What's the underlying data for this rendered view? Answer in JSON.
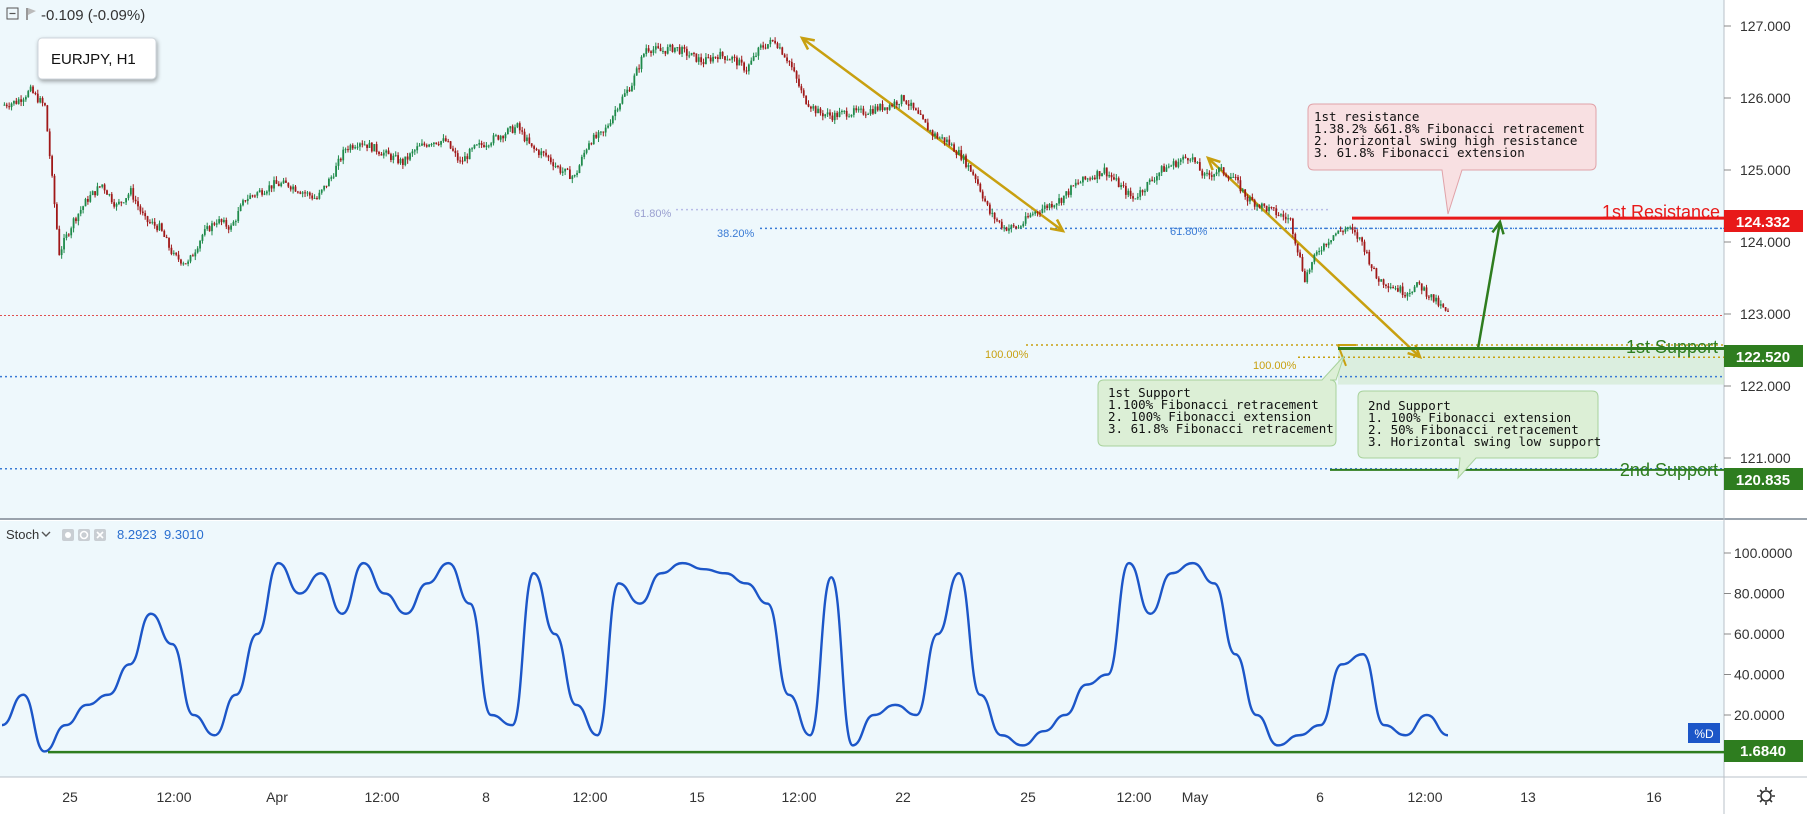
{
  "header": {
    "change": "-0.109 (-0.09%)",
    "symbol": "EURJPY, H1"
  },
  "colors": {
    "background": "#eef8fc",
    "up_candle": "#1e8a4a",
    "down_candle": "#a01818",
    "resistance": "#e81919",
    "support": "#2e7d1f",
    "fib_arrow": "#c8a010",
    "fib_blue": "#3a7bd5",
    "stoch_line": "#1c56c8"
  },
  "price_axis": {
    "ticks": [
      "127.000",
      "126.000",
      "125.000",
      "124.000",
      "123.000",
      "122.000",
      "121.000"
    ],
    "tick_values": [
      127,
      126,
      125,
      124,
      123,
      122,
      121
    ],
    "range": [
      120.38,
      127.28
    ]
  },
  "time_axis": {
    "labels": [
      "25",
      "12:00",
      "Apr",
      "12:00",
      "8",
      "12:00",
      "15",
      "12:00",
      "22",
      "25",
      "12:00",
      "May",
      "6",
      "12:00",
      "13",
      "16"
    ]
  },
  "levels": {
    "resistance": {
      "label": "1st Resistance",
      "value": "124.332",
      "price": 124.332
    },
    "support1": {
      "label": "1st Support",
      "value": "122.520",
      "price": 122.52
    },
    "support2": {
      "label": "2nd Support",
      "value": "120.835",
      "price": 120.835
    }
  },
  "fib_labels": {
    "a": "61.80%",
    "b": "38.20%",
    "c": "61.80%",
    "d": "100.00%",
    "e": "100.00%"
  },
  "notes": {
    "resistance": {
      "title": "1st resistance",
      "lines": [
        "1.38.2% &61.8% Fibonacci retracement",
        "2. horizontal swing high resistance",
        "3. 61.8%  Fibonacci extension"
      ]
    },
    "support1": {
      "title": "1st Support",
      "lines": [
        "1.100% Fibonacci retracement",
        "2. 100% Fibonacci extension",
        "3. 61.8% Fibonacci retracement"
      ]
    },
    "support2": {
      "title": "2nd Support",
      "lines": [
        "1. 100% Fibonacci extension",
        "2. 50% Fibonacci retracement",
        "3. Horizontal swing low support"
      ]
    }
  },
  "stoch": {
    "name": "Stoch",
    "k": "8.2923",
    "d": "9.3010",
    "series_label": "%D",
    "level_value": "1.6840",
    "axis_ticks": [
      "100.0000",
      "80.0000",
      "60.0000",
      "40.0000",
      "20.0000"
    ]
  },
  "chart_data": {
    "type": "line",
    "title": "EURJPY, H1",
    "xlabel": "",
    "ylabel": "",
    "ylim": [
      120.38,
      127.28
    ],
    "series": [
      {
        "name": "EURJPY",
        "values": [
          125.9,
          125.95,
          126.1,
          125.88,
          123.85,
          124.3,
          124.6,
          124.8,
          124.5,
          124.7,
          124.3,
          124.2,
          123.8,
          123.7,
          124.1,
          124.3,
          124.2,
          124.6,
          124.7,
          124.8,
          124.8,
          124.7,
          124.6,
          124.9,
          125.3,
          125.4,
          125.3,
          125.2,
          125.1,
          125.3,
          125.4,
          125.4,
          125.1,
          125.3,
          125.4,
          125.5,
          125.6,
          125.3,
          125.2,
          125.0,
          124.9,
          125.4,
          125.5,
          125.9,
          126.2,
          126.7,
          126.65,
          126.7,
          126.6,
          126.5,
          126.6,
          126.55,
          126.4,
          126.7,
          126.8,
          126.5,
          126.0,
          125.8,
          125.75,
          125.8,
          125.8,
          125.85,
          125.9,
          126.0,
          125.75,
          125.5,
          125.4,
          125.2,
          124.9,
          124.4,
          124.2,
          124.2,
          124.4,
          124.5,
          124.6,
          124.8,
          124.9,
          125.0,
          124.8,
          124.6,
          124.8,
          125.0,
          125.1,
          125.2,
          124.9,
          125.0,
          124.9,
          124.6,
          124.5,
          124.4,
          124.3,
          123.5,
          123.9,
          124.1,
          124.2,
          124.0,
          123.5,
          123.4,
          123.3,
          123.4,
          123.2,
          123.0
        ]
      },
      {
        "name": "Stoch %D",
        "values": [
          15,
          30,
          2,
          15,
          25,
          30,
          45,
          70,
          55,
          20,
          10,
          30,
          60,
          95,
          80,
          90,
          70,
          95,
          80,
          70,
          85,
          95,
          75,
          20,
          15,
          90,
          60,
          25,
          10,
          85,
          75,
          90,
          95,
          92,
          90,
          85,
          75,
          30,
          10,
          88,
          5,
          20,
          25,
          20,
          60,
          90,
          30,
          10,
          5,
          12,
          20,
          35,
          40,
          95,
          70,
          90,
          95,
          85,
          50,
          20,
          5,
          10,
          15,
          45,
          50,
          15,
          10,
          20,
          10
        ]
      }
    ]
  }
}
